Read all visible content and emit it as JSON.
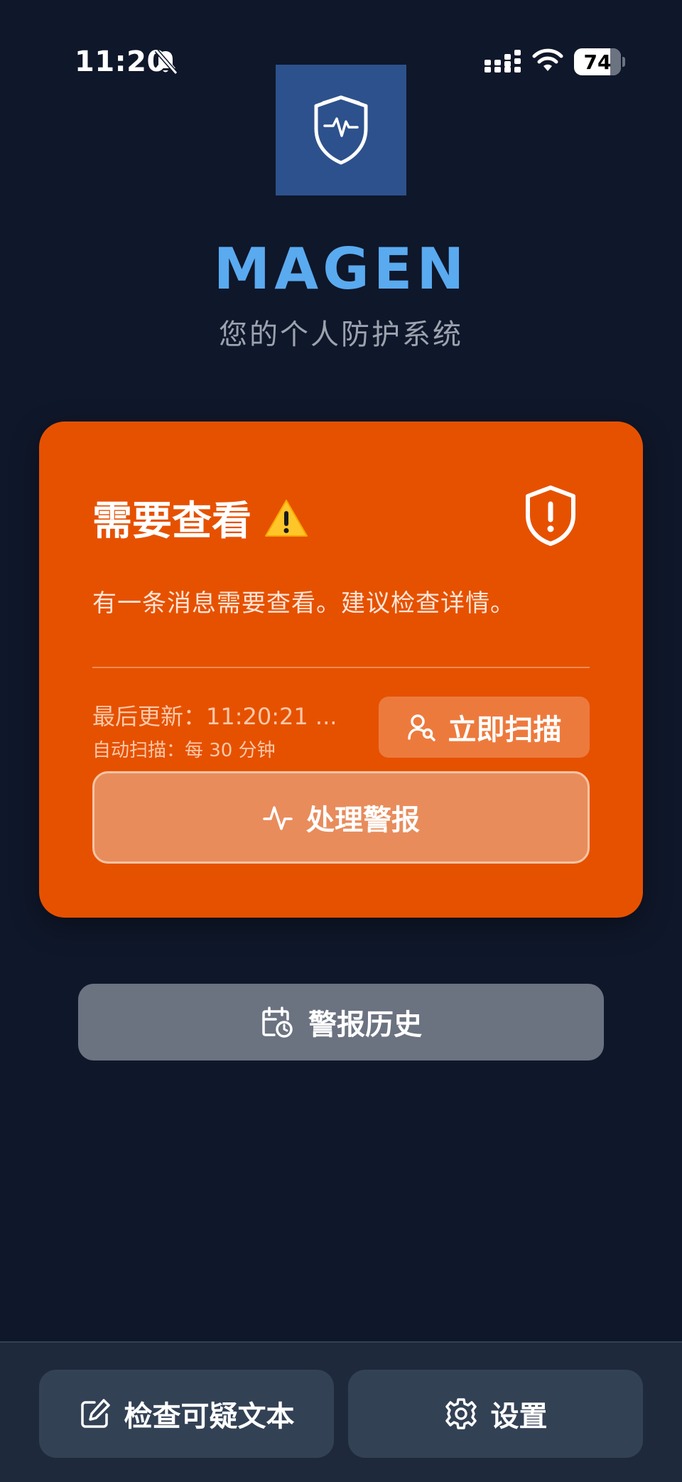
{
  "status_bar": {
    "time": "11:20",
    "battery": "74"
  },
  "header": {
    "app_name": "MAGEN",
    "subtitle": "您的个人防护系统"
  },
  "status_card": {
    "title": "需要查看",
    "message": "有一条消息需要查看。建议检查详情。",
    "last_update": "最后更新：11:20:21 ...",
    "auto_scan": "自动扫描：每 30 分钟",
    "scan_button": "立即扫描",
    "handle_alert_button": "处理警报",
    "background_color": "#e65100"
  },
  "history_button": "警报历史",
  "bottom_bar": {
    "check_text_button": "检查可疑文本",
    "settings_button": "设置"
  },
  "colors": {
    "background": "#0f172a",
    "accent": "#5aaaf0",
    "alert": "#e65100"
  },
  "icons": {
    "logo": "shield-heartbeat-icon",
    "status_shield": "shield-alert-icon",
    "warning": "warning-icon",
    "scan": "user-search-icon",
    "activity": "activity-icon",
    "history": "calendar-clock-icon",
    "edit": "edit-icon",
    "settings": "gear-icon"
  }
}
